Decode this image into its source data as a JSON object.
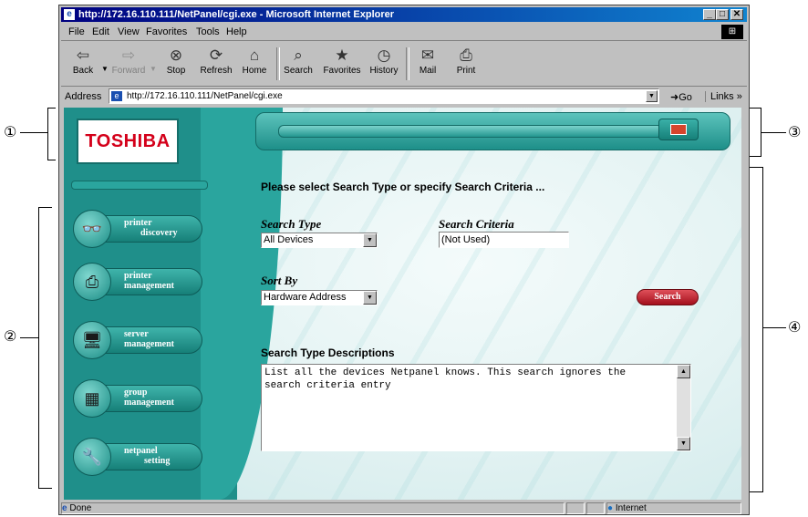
{
  "callouts": [
    "①",
    "②",
    "③",
    "④"
  ],
  "window": {
    "title": "http://172.16.110.111/NetPanel/cgi.exe - Microsoft Internet Explorer",
    "controls": {
      "minimize": "_",
      "maximize": "□",
      "close": "✕"
    }
  },
  "menu": [
    "File",
    "Edit",
    "View",
    "Favorites",
    "Tools",
    "Help"
  ],
  "toolbar": {
    "back": "Back",
    "forward": "Forward",
    "stop": "Stop",
    "refresh": "Refresh",
    "home": "Home",
    "search": "Search",
    "favorites": "Favorites",
    "history": "History",
    "mail": "Mail",
    "print": "Print"
  },
  "address": {
    "label": "Address",
    "url": "http://172.16.110.111/NetPanel/cgi.exe",
    "go": "Go",
    "links": "Links »"
  },
  "brand": {
    "logo": "TOSHIBA",
    "color": "#d4001a"
  },
  "sidebar": {
    "items": [
      {
        "line1": "printer",
        "line2": "discovery",
        "icon": "binoculars-icon"
      },
      {
        "line1": "printer",
        "line2": "management",
        "icon": "printer-gear-icon"
      },
      {
        "line1": "server",
        "line2": "management",
        "icon": "server-computer-icon"
      },
      {
        "line1": "group",
        "line2": "management",
        "icon": "printers-group-icon"
      },
      {
        "line1": "netpanel",
        "line2": "setting",
        "icon": "wrench-icon"
      }
    ]
  },
  "main": {
    "prompt": "Please select Search Type or specify Search Criteria ...",
    "search_type_label": "Search Type",
    "search_type_value": "All Devices",
    "search_criteria_label": "Search Criteria",
    "search_criteria_value": "(Not Used)",
    "sort_by_label": "Sort By",
    "sort_by_value": "Hardware Address",
    "search_button": "Search",
    "desc_heading": "Search Type Descriptions",
    "desc_text": "List all the devices Netpanel knows. This search ignores the search criteria entry"
  },
  "status": {
    "left": "Done",
    "zone": "Internet"
  }
}
